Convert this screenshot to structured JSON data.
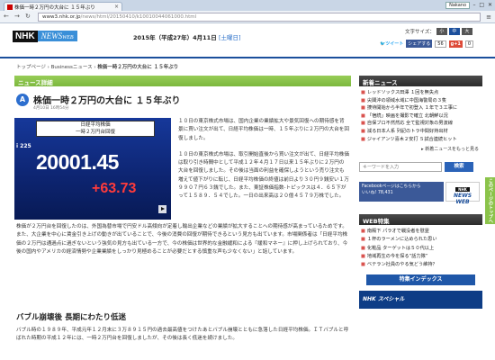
{
  "browser": {
    "tab_title": "株価一時２万円の大台に １５年ぶり",
    "profile": "Nakano",
    "window_controls": "–  □  ✕",
    "url_host": "www3.nhk.or.jp",
    "url_path": "/news/html/20150410/k10010044061000.html"
  },
  "header": {
    "logo_nhk": "NHK",
    "logo_news": "NEWS",
    "logo_web": "WEB",
    "date_text": "2015年（平成27年）4月11日",
    "date_live": "[土曜日]",
    "font_size_label": "文字サイズ：",
    "font_sizes": [
      "小",
      "中",
      "大"
    ],
    "share_tweet": "ツイート",
    "share_fb": "シェアする",
    "share_count": "56",
    "share_g": "g+1",
    "share_g_count": "0"
  },
  "breadcrumb": {
    "top": "トップページ",
    "sep1": "›",
    "section": "Businessニュース",
    "sep2": "›",
    "current": "株価一時２万円の大台に １５年ぶり"
  },
  "article": {
    "section_label": "ニュース詳細",
    "icon_glyph": "A",
    "headline": "株価一時２万円の大台に １５年ぶり",
    "posted": "4月10日 16時54分",
    "photo_caption_l1": "日経平均株価",
    "photo_caption_l2": "一時２万円台回復",
    "photo_index_label": "i 225",
    "photo_price": "20001.45",
    "photo_change": "+63.73",
    "para1": "１０日の東京株式市場は、国内企業の業績拡大や景気回復への期待感を背景に買い注文が出て、日経平均株価は一時、１５年ぶりに２万円の大台を回復しました。",
    "para2": "１０日の東京株式市場は、取引開始直後から買い注文が出て、日経平均株価は取り引き時間中として平成１２年４月１７日以来１５年ぶりに２万円の大台を回復しました。その後は当面の利益を確保しようという売り注文も増えて値下がりに転じ、日経平均株価の終値は前日より３０円９銭安い１万９９０７円６３銭でした。また、東証株価指数-トピックスは４．６５下がって１５８９．５４でした。一日の出来高は２０億４５７９万株でした。",
    "para3": "株価が２万円台を回復したのは、外国為替市場で円安ドル高傾向が定着し輸出企業などの業績が拡大することへの期待感が高まっているためです。また、大企業を中心に賃金引き上げの動きが出ていることで、今後の消費の回復が期待できるという見方も出ています。市場関係者は「日経平均株価の２万円は通過点に過ぎないという強気の見方も出ている一方で、今の株価は世界的な金融緩和による『緩和マネー』に押し上げられており、今後の国内やアメリカの経済情勢や企業業績をしっかり見極めることが必要だとする慎重な声も少なくない」と話しています。",
    "subhead": "バブル崩壊後 長期にわたり低迷",
    "para4": "バブル時の１９８９年、平成元年１２月末に３万８９１５円の過去最高値をつけたあとバブル崩壊とともに急落した日経平均株価。ＩＴバブルと呼ばれた時期の平成１２年には、一時２万円台を回復しましたが、その後は長く低迷を続けました。"
  },
  "sidebar": {
    "latest_title": "新着ニュース",
    "latest": [
      "レッドソックス田澤 １回を無失点",
      "尖閣沖の領域水域に中国海警局の３隻",
      "捜待開始から半年で初登入 １年で３工事に",
      "「宿続」映画を撮影で確立 北朝鮮以況",
      "自保ブロ不然然応 全て監視対象の男波線",
      "減る日本人系 列記のトラ中間好持出材",
      "ジャイアンツ喜木２安打 ５試合連続ヒット"
    ],
    "more_label": "新着ニュースをもっと見る",
    "search_placeholder": "キーワードを入力",
    "search_button": "検索",
    "fb_banner_l1": "Facebookページはこちらから",
    "fb_banner_l2": "いいね! 78,431",
    "newsweb_mini_nhk": "NHK",
    "newsweb_mini": "NEWS WEB",
    "web_title": "WEB特集",
    "web_items": [
      "南殿下 パラオで戦没者を慰霊",
      "１杯のラーメンに込められた思い",
      "化粧品 ターゲットは５０代以上",
      "地域再生の今を探る“話力隊”",
      "ベテラン社員のやる気どう維持？"
    ],
    "feature_button": "特集インデックス",
    "ad_label": "NHK スペシャル"
  },
  "page_top": "このページのトップへ"
}
